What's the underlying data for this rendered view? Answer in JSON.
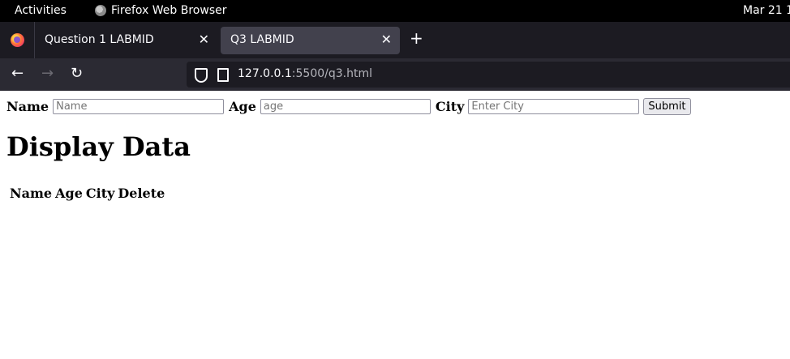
{
  "topbar": {
    "activities": "Activities",
    "app_name": "Firefox Web Browser",
    "clock": "Mar 21  1"
  },
  "tabs": [
    {
      "label": "Question 1 LABMID",
      "active": false
    },
    {
      "label": "Q3 LABMID",
      "active": true
    }
  ],
  "nav": {
    "url_host": "127.0.0.1",
    "url_rest": ":5500/q3.html"
  },
  "form": {
    "name_label": "Name",
    "name_placeholder": "Name",
    "age_label": "Age",
    "age_placeholder": "age",
    "city_label": "City",
    "city_placeholder": "Enter City",
    "submit_label": "Submit"
  },
  "page": {
    "heading": "Display Data"
  },
  "table": {
    "headers": [
      "Name",
      "Age",
      "City",
      "Delete"
    ]
  },
  "icons": {
    "browser": "firefox-icon",
    "back": "back-arrow-icon",
    "forward": "forward-arrow-icon",
    "reload": "reload-icon",
    "shield": "shield-icon",
    "page": "page-icon",
    "close": "close-icon",
    "new_tab": "plus-icon"
  }
}
